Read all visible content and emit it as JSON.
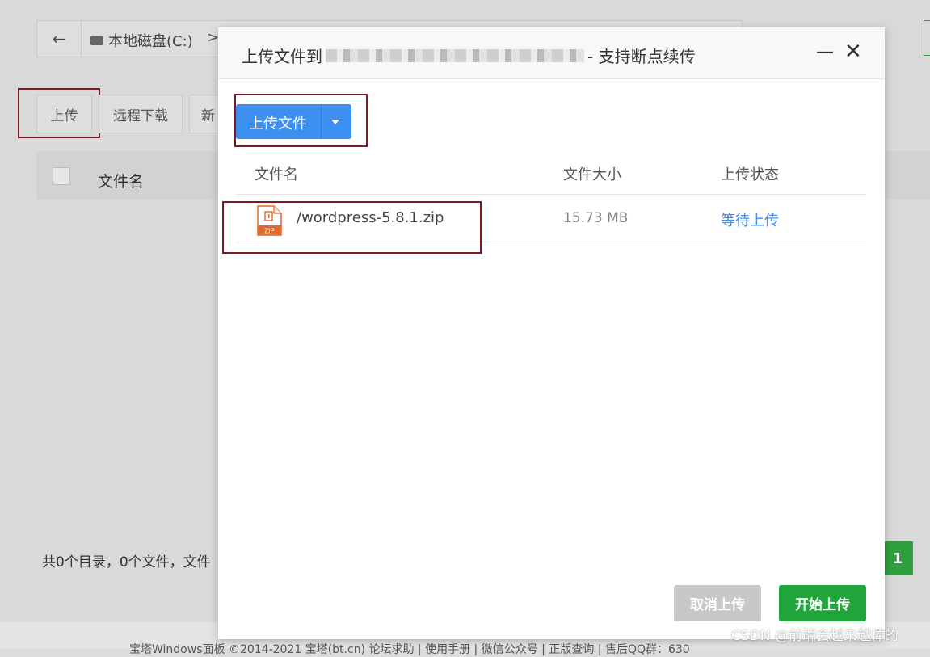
{
  "background": {
    "breadcrumb_disk": "本地磁盘(C:)",
    "breadcrumb_separator": ">",
    "toolbar": {
      "upload": "上传",
      "remote_download": "远程下载",
      "new_partial": "新"
    },
    "column_filename": "文件名",
    "footer_summary": "共0个目录，0个文件，文件",
    "page_number": "1",
    "bottom_links": "宝塔Windows面板 ©2014-2021 宝塔(bt.cn)  论坛求助 | 使用手册 | 微信公众号 | 正版查询 | 售后QQ群：630"
  },
  "modal": {
    "title_prefix": "上传文件到",
    "title_suffix": "- 支持断点续传",
    "minimize_glyph": "—",
    "close_glyph": "✕",
    "upload_button": "上传文件",
    "columns": {
      "name": "文件名",
      "size": "文件大小",
      "status": "上传状态"
    },
    "files": [
      {
        "name": "/wordpress-5.8.1.zip",
        "size": "15.73 MB",
        "status": "等待上传",
        "type_label": "ZIP"
      }
    ],
    "cancel_button": "取消上传",
    "start_button": "开始上传"
  },
  "watermark": "CSDN @前端会越来越棒的",
  "colors": {
    "primary_blue": "#3d8ff0",
    "green": "#20a53a",
    "highlight_red": "#7a1a24",
    "status_blue": "#3d8ff0"
  }
}
